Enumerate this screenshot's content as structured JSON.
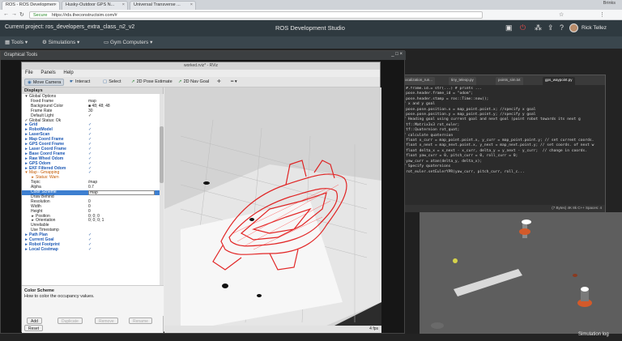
{
  "browser": {
    "tabs": [
      {
        "label": "ROS - ROS Developmen"
      },
      {
        "label": "Husky-Outdoor GPS N..."
      },
      {
        "label": "Universal Transverse ..."
      }
    ],
    "profile": "Brinks",
    "address_secure": "Secure",
    "address": "https://rds.theconstructsim.com/#"
  },
  "rds": {
    "current_project": "Current project: ros_developers_extra_class_n2_v2",
    "app_title": "ROS Development Studio",
    "user": "Rick Tellez",
    "menu": [
      "Tools",
      "Simulations",
      "Gym Computers"
    ]
  },
  "graphical_tools": {
    "title": "Graphical Tools"
  },
  "rviz": {
    "window_title": "worked.rviz* - RViz",
    "menu": [
      "File",
      "Panels",
      "Help"
    ],
    "toolbar": [
      {
        "label": "Move Camera",
        "icon": "camera-icon",
        "active": true
      },
      {
        "label": "Interact",
        "icon": "interact-icon",
        "active": false
      },
      {
        "label": "Select",
        "icon": "select-icon",
        "active": false
      },
      {
        "label": "2D Pose Estimate",
        "icon": "pose-icon",
        "active": false
      },
      {
        "label": "2D Nav Goal",
        "icon": "goal-icon",
        "active": false
      }
    ],
    "displays_title": "Displays",
    "tree": [
      {
        "indent": 0,
        "label": "Global Options",
        "style": "plain",
        "icon": "▾"
      },
      {
        "indent": 1,
        "label": "Fixed Frame",
        "value": "map"
      },
      {
        "indent": 1,
        "label": "Background Color",
        "value": "■ 48; 48; 48"
      },
      {
        "indent": 1,
        "label": "Frame Rate",
        "value": "30"
      },
      {
        "indent": 1,
        "label": "Default Light",
        "value": "✓"
      },
      {
        "indent": 0,
        "label": "Global Status: Ok",
        "style": "plain",
        "icon": "✓"
      },
      {
        "indent": 0,
        "label": "Grid",
        "style": "blue",
        "icon": "▸",
        "check": "✓"
      },
      {
        "indent": 0,
        "label": "RobotModel",
        "style": "blue",
        "icon": "▸",
        "check": "✓"
      },
      {
        "indent": 0,
        "label": "LaserScan",
        "style": "blue",
        "icon": "▸",
        "check": "✓"
      },
      {
        "indent": 0,
        "label": "Map Coord Frame",
        "style": "blue",
        "icon": "▸",
        "check": "✓"
      },
      {
        "indent": 0,
        "label": "GPS Coord Frame",
        "style": "blue",
        "icon": "▸",
        "check": "✓"
      },
      {
        "indent": 0,
        "label": "Laser Coord Frame",
        "style": "blue",
        "icon": "▸",
        "check": "✓"
      },
      {
        "indent": 0,
        "label": "Base Coord Frame",
        "style": "blue",
        "icon": "▸",
        "check": "✓"
      },
      {
        "indent": 0,
        "label": "Raw Wheel Odom",
        "style": "blue",
        "icon": "▸",
        "check": "✓"
      },
      {
        "indent": 0,
        "label": "GPS Odom",
        "style": "blue",
        "icon": "▸",
        "check": "✓"
      },
      {
        "indent": 0,
        "label": "EKF Filtered Odom",
        "style": "blue",
        "icon": "▸",
        "check": "✓"
      },
      {
        "indent": 0,
        "label": "Map - Gmapping",
        "style": "orange",
        "icon": "▾",
        "check": "✓"
      },
      {
        "indent": 1,
        "label": "Status: Warn",
        "style": "orange",
        "icon": "▸"
      },
      {
        "indent": 1,
        "label": "Topic",
        "value": "/map"
      },
      {
        "indent": 1,
        "label": "Alpha",
        "value": "0.7"
      },
      {
        "indent": 1,
        "label": "Color Scheme",
        "value": "map",
        "selected": true
      },
      {
        "indent": 1,
        "label": "Draw Behind",
        "value": ""
      },
      {
        "indent": 1,
        "label": "Resolution",
        "value": "0"
      },
      {
        "indent": 1,
        "label": "Width",
        "value": "0"
      },
      {
        "indent": 1,
        "label": "Height",
        "value": "0"
      },
      {
        "indent": 1,
        "label": "Position",
        "value": "0; 0; 0",
        "icon": "▸"
      },
      {
        "indent": 1,
        "label": "Orientation",
        "value": "0; 0; 0; 1",
        "icon": "▸"
      },
      {
        "indent": 1,
        "label": "Unreliable",
        "value": ""
      },
      {
        "indent": 1,
        "label": "Use Timestamp",
        "value": ""
      },
      {
        "indent": 0,
        "label": "Path Plan",
        "style": "blue",
        "icon": "▸",
        "check": "✓"
      },
      {
        "indent": 0,
        "label": "Current Goal",
        "style": "blue",
        "icon": "▸",
        "check": "✓"
      },
      {
        "indent": 0,
        "label": "Robot Footprint",
        "style": "blue",
        "icon": "▸",
        "check": "✓"
      },
      {
        "indent": 0,
        "label": "Local Costmap",
        "style": "blue",
        "icon": "▸",
        "check": "✓"
      }
    ],
    "description_title": "Color Scheme",
    "description_text": "How to color the occupancy values.",
    "buttons": [
      {
        "label": "Add",
        "enabled": true
      },
      {
        "label": "Duplicate",
        "enabled": false
      },
      {
        "label": "Remove",
        "enabled": false
      },
      {
        "label": "Rename",
        "enabled": false
      }
    ],
    "reset_label": "Reset",
    "fps": "4 fps"
  },
  "editor": {
    "tabs": [
      "localization_run...",
      "tiny_teleop.py",
      "points_sim.txt",
      "gps_waypoint.py"
    ],
    "code": [
      "    #.frame.id.= str(...) # prints ...",
      "    pose.header.frame_id = \"odom\";",
      "    pose.header.stamp = ros::Time::now();",
      "",
      "  // x and y goal",
      "    pose.pose.position.x = map_point.point.x; //specify x goal",
      "    pose.pose.position.y = map_point.point.y; //specify y goal",
      "",
      "  // Heading goal using current goal and next goal (point robot towards its next g",
      "",
      "    tf::Matrix3x3 rot_euler;",
      "    tf::Quaternion rot_quat;",
      "",
      "  // calculate quaternion",
      "    float x_curr = map_point.point.x, y_curr = map_point.point.y; // set current coords.",
      "    float x_next = map_next.point.x, y_next = map_next.point.y; // set coords. of next w",
      "    float delta_x = x_next - x_curr, delta_y = y_next - y_curr;  // change in coords.",
      "    float yaw_curr = 0, pitch_curr = 0, roll_curr = 0;",
      "    yaw_curr = atan(delta_y, delta_x);",
      "",
      "  // Specify quaternions",
      "    rot_euler.setEulerYPR(yaw_curr, pitch_curr, roll_c..."
    ],
    "status": "(7 Bytes)   4K 8k   C++   Spaces: 4"
  },
  "simulation_log": "Simulation log"
}
